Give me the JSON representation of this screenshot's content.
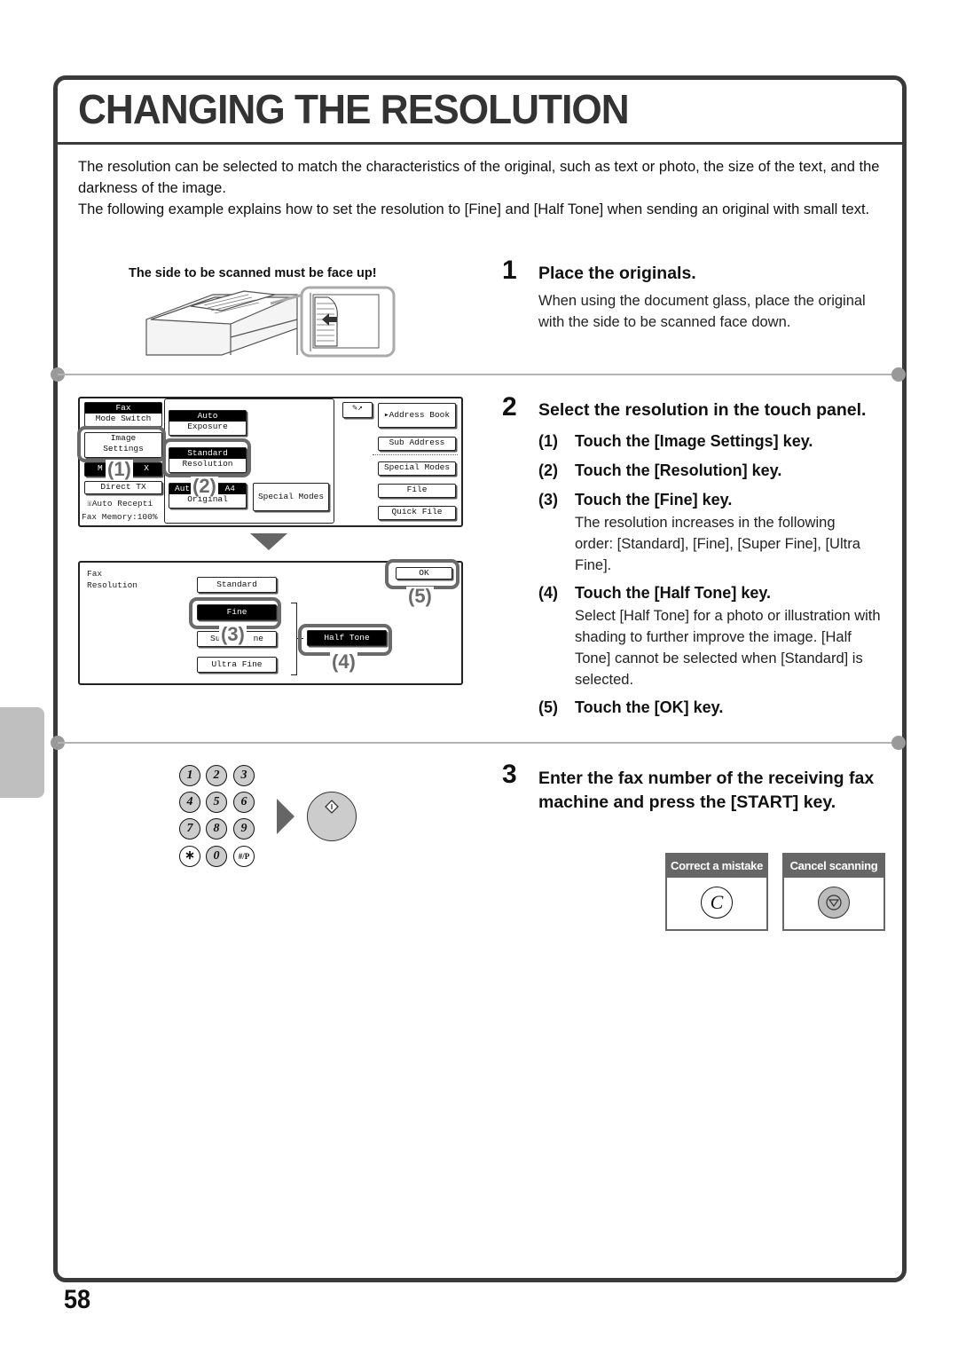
{
  "page": {
    "title": "CHANGING THE RESOLUTION",
    "intro": [
      "The resolution can be selected to match the characteristics of the original, such as text or photo, the size of the text, and the darkness of the image.",
      "The following example explains how to set the resolution to [Fine] and [Half Tone] when sending an original with small text."
    ],
    "page_number": "58"
  },
  "illustration": {
    "face_up_caption": "The side to be scanned must be face up!"
  },
  "steps": [
    {
      "number": "1",
      "heading": "Place the originals.",
      "body": "When using the document glass, place the original with the side to be scanned face down."
    },
    {
      "number": "2",
      "heading": "Select the resolution in the touch panel.",
      "substeps": [
        {
          "number": "(1)",
          "heading": "Touch the [Image Settings] key.",
          "body": ""
        },
        {
          "number": "(2)",
          "heading": "Touch the [Resolution] key.",
          "body": ""
        },
        {
          "number": "(3)",
          "heading": "Touch the [Fine] key.",
          "body": "The resolution increases in the following order: [Standard], [Fine], [Super Fine], [Ultra Fine]."
        },
        {
          "number": "(4)",
          "heading": "Touch the [Half Tone] key.",
          "body": "Select [Half Tone] for a photo or illustration with shading to further improve the image. [Half Tone] cannot be selected when [Standard] is selected."
        },
        {
          "number": "(5)",
          "heading": "Touch the [OK] key.",
          "body": ""
        }
      ]
    },
    {
      "number": "3",
      "heading": "Enter the fax number of the receiving fax machine and press the [START] key."
    }
  ],
  "fax_panel": {
    "mode_switch_top": "Fax",
    "mode_switch_bottom": "Mode Switch",
    "image_settings": [
      "Image",
      "Settings"
    ],
    "memory_tx_partial": [
      "M",
      "X"
    ],
    "direct_tx": "Direct TX",
    "auto_reception": "Auto Recepti",
    "fax_memory": "Fax Memory:100%",
    "exposure_top": "Auto",
    "exposure_bottom": "Exposure",
    "resolution_top": "Standard",
    "resolution_bottom": "Resolution",
    "original_top_left": "Aut",
    "original_top_right": "A4",
    "original_bottom": "Original",
    "special_modes_center": "Special Modes",
    "address_book": "Address Book",
    "sub_address": "Sub Address",
    "special_modes_right": "Special Modes",
    "file": "File",
    "quick_file": "Quick File"
  },
  "resolution_panel": {
    "label_line1": "Fax",
    "label_line2": "Resolution",
    "standard": "Standard",
    "fine": "Fine",
    "super_fine_left": "Su",
    "super_fine_right": "ne",
    "ultra_fine": "Ultra Fine",
    "half_tone": "Half Tone",
    "ok": "OK"
  },
  "callouts": [
    "(1)",
    "(2)",
    "(3)",
    "(4)",
    "(5)"
  ],
  "keypad": {
    "keys": [
      "1",
      "2",
      "3",
      "4",
      "5",
      "6",
      "7",
      "8",
      "9",
      "∗",
      "0",
      "#/P"
    ]
  },
  "key_boxes": [
    {
      "label": "Correct a mistake",
      "glyph": "C"
    },
    {
      "label": "Cancel scanning",
      "glyph": "stop"
    }
  ]
}
